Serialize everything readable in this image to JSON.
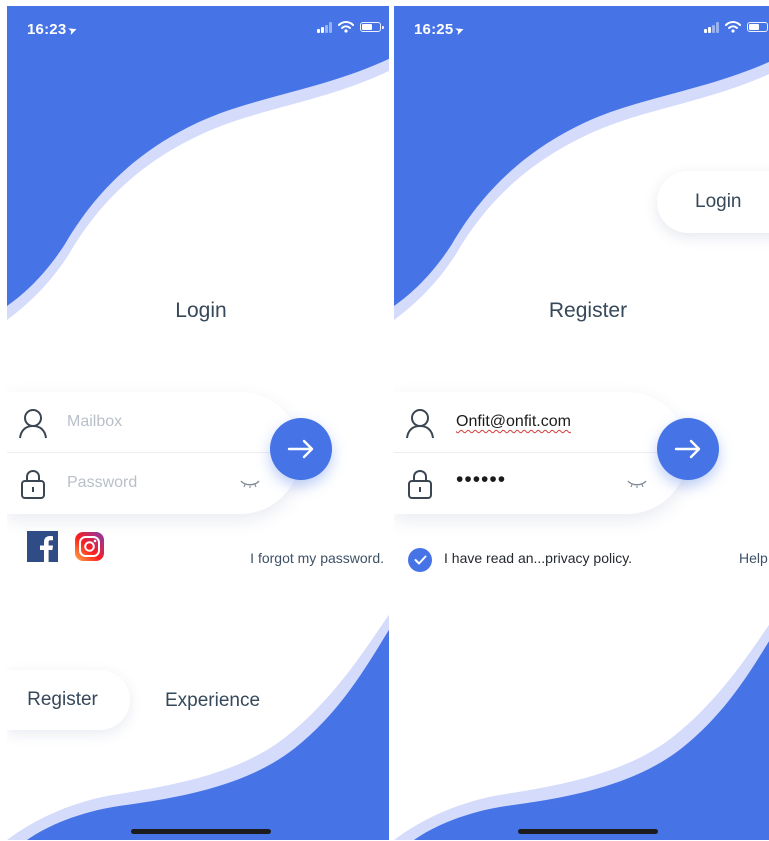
{
  "colors": {
    "accent": "#4673e6",
    "wave_edge": "#d4dbfb",
    "text": "#36485a"
  },
  "login_screen": {
    "status_time": "16:23",
    "title": "Login",
    "mailbox_placeholder": "Mailbox",
    "password_placeholder": "Password",
    "forgot_password": "I forgot my password.",
    "register_label": "Register",
    "experience_label": "Experience",
    "social_icons": [
      "facebook-icon",
      "instagram-icon"
    ]
  },
  "register_screen": {
    "status_time": "16:25",
    "title": "Register",
    "login_label": "Login",
    "email_value": "Onfit@onfit.com",
    "password_masked": "••••••",
    "agreement_text": "I have read an...privacy policy.",
    "agreement_checked": true,
    "help_label": "Help"
  },
  "status_bar": {
    "battery_level": 0.5,
    "signal_bars_active": 2,
    "signal_bars_total": 4
  }
}
